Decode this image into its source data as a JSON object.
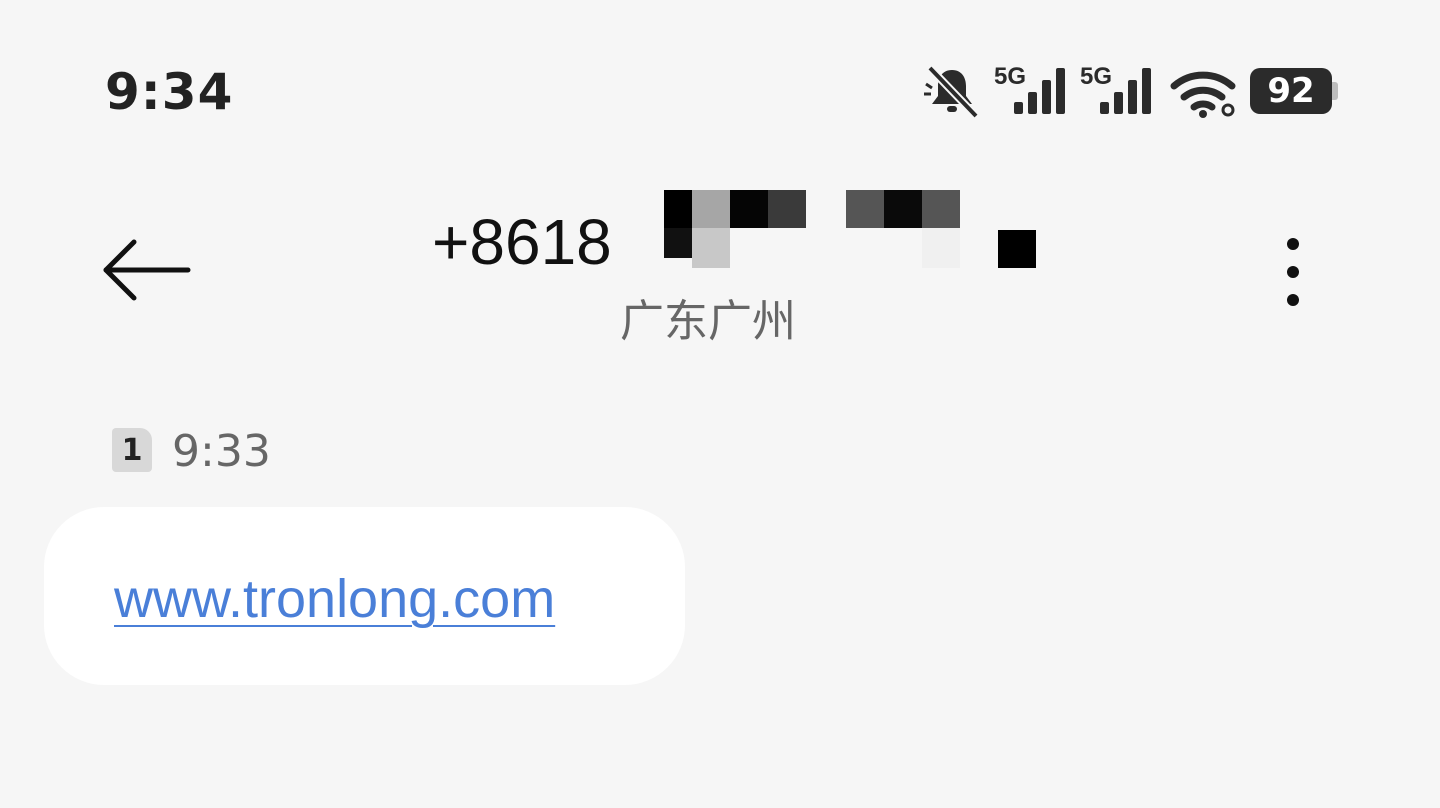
{
  "status_bar": {
    "time": "9:34",
    "battery_level": "92",
    "network_1": "5G",
    "network_2": "5G",
    "icons": [
      "bell-muted-icon",
      "signal-5g-icon",
      "signal-5g-icon",
      "wifi-icon",
      "battery-icon"
    ]
  },
  "header": {
    "phone_number": "+8618",
    "location": "广东广州",
    "back_icon": "back-arrow-icon",
    "more_icon": "more-vertical-icon"
  },
  "conversation": {
    "sim_slot": "1",
    "timestamp": "9:33",
    "messages": [
      {
        "text": "www.tronlong.com",
        "type": "link"
      }
    ]
  },
  "colors": {
    "background": "#f6f6f6",
    "bubble": "#ffffff",
    "link": "#4a7fd8",
    "secondary_text": "#666666"
  }
}
